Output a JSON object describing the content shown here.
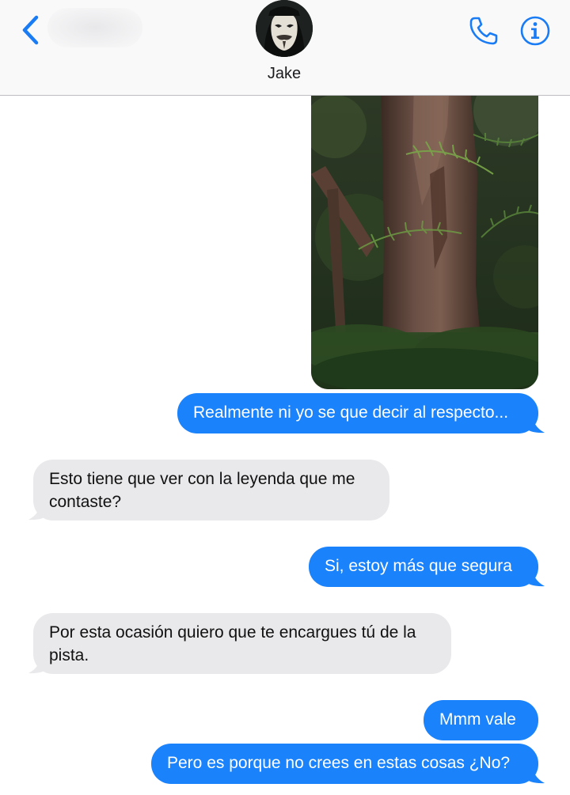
{
  "header": {
    "contact_name": "Jake",
    "avatar_icon": "anonymous-mask-icon",
    "back_icon": "chevron-left-icon",
    "call_icon": "phone-icon",
    "info_icon": "info-icon"
  },
  "messages": [
    {
      "type": "image",
      "direction": "sent",
      "content": "forest-tree-fern-photo"
    },
    {
      "type": "text",
      "direction": "sent",
      "text": "Realmente ni yo se que decir al respecto..."
    },
    {
      "type": "text",
      "direction": "received",
      "text": "Esto tiene que ver con la leyenda que me contaste?"
    },
    {
      "type": "text",
      "direction": "sent",
      "text": "Si, estoy más que segura"
    },
    {
      "type": "text",
      "direction": "received",
      "text": "Por esta ocasión quiero que te encargues tú de la pista."
    },
    {
      "type": "text",
      "direction": "sent",
      "text": "Mmm vale"
    },
    {
      "type": "text",
      "direction": "sent",
      "text": "Pero es porque no crees en estas cosas ¿No?"
    }
  ],
  "colors": {
    "sent_bubble": "#1a82fb",
    "received_bubble": "#e9e9eb",
    "accent": "#1a7cf5"
  }
}
